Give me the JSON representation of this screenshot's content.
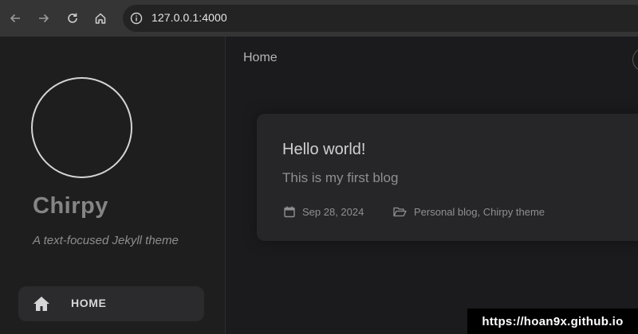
{
  "browser": {
    "url": "127.0.0.1:4000",
    "icons": [
      "back-icon",
      "forward-icon",
      "reload-icon",
      "home-icon",
      "info-icon"
    ]
  },
  "sidebar": {
    "site_title": "Chirpy",
    "site_subtitle": "A text-focused Jekyll theme",
    "nav": [
      {
        "label": "HOME",
        "icon": "home-icon"
      }
    ]
  },
  "topbar": {
    "title": "Home"
  },
  "post": {
    "title": "Hello world!",
    "excerpt": "This is my first blog",
    "date": "Sep 28, 2024",
    "categories": "Personal blog, Chirpy theme"
  },
  "watermark": "https://hoan9x.github.io",
  "colors": {
    "page_bg": "#1b1b1e",
    "sidebar_bg": "#1e1e1e",
    "card_bg": "#262629",
    "toolbar_bg": "#353535"
  }
}
